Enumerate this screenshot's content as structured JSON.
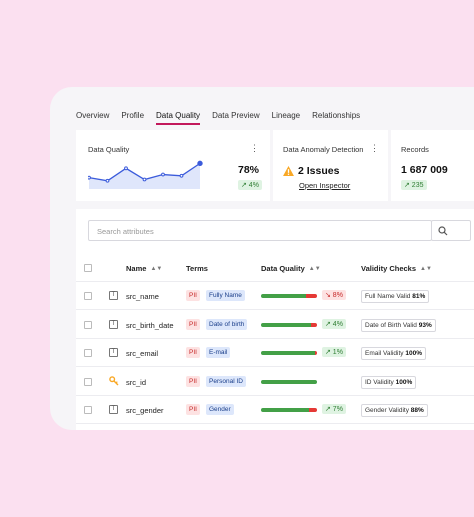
{
  "tabs": [
    "Overview",
    "Profile",
    "Data Quality",
    "Data Preview",
    "Lineage",
    "Relationships"
  ],
  "active_tab": "Data Quality",
  "cards": {
    "quality": {
      "title": "Data Quality",
      "value": "78%",
      "delta": "↗ 4%",
      "sparkline": [
        55,
        50,
        70,
        52,
        60,
        58,
        78
      ]
    },
    "anomaly": {
      "title": "Data Anomaly Detection",
      "value": "2 Issues",
      "link": "Open Inspector"
    },
    "records": {
      "title": "Records",
      "value": "1 687 009",
      "delta": "↗ 235"
    }
  },
  "search": {
    "placeholder": "Search attributes"
  },
  "columns": {
    "name": "Name",
    "terms": "Terms",
    "quality": "Data Quality",
    "validity": "Validity Checks"
  },
  "rows": [
    {
      "icon": "text-type-icon",
      "icon_glyph": "T",
      "name": "src_name",
      "pii": "PII",
      "term": "Fully Name",
      "quality": 0.8,
      "delta": "↘ 8%",
      "trend": "down",
      "check": "Full Name Valid",
      "check_pct": "81%"
    },
    {
      "icon": "text-type-icon",
      "icon_glyph": "T",
      "name": "src_birth_date",
      "pii": "PII",
      "term": "Date of birth",
      "quality": 0.9,
      "delta": "↗ 4%",
      "trend": "up",
      "check": "Date of Birth Valid",
      "check_pct": "93%"
    },
    {
      "icon": "text-type-icon",
      "icon_glyph": "T",
      "name": "src_email",
      "pii": "PII",
      "term": "E-mail",
      "quality": 0.96,
      "delta": "↗ 1%",
      "trend": "up",
      "check": "Email Validity",
      "check_pct": "100%"
    },
    {
      "icon": "key-icon",
      "icon_glyph": "",
      "name": "src_id",
      "pii": "PII",
      "term": "Personal ID",
      "quality": 1.0,
      "delta": "",
      "trend": "",
      "check": "ID Validity",
      "check_pct": "100%"
    },
    {
      "icon": "text-type-icon",
      "icon_glyph": "T",
      "name": "src_gender",
      "pii": "PII",
      "term": "Gender",
      "quality": 0.86,
      "delta": "↗ 7%",
      "trend": "up",
      "check": "Gender Validity",
      "check_pct": "88%"
    }
  ],
  "colors": {
    "accent": "#c2185b",
    "good": "#43a047",
    "bad": "#e53935",
    "line": "#3b5bdb"
  }
}
